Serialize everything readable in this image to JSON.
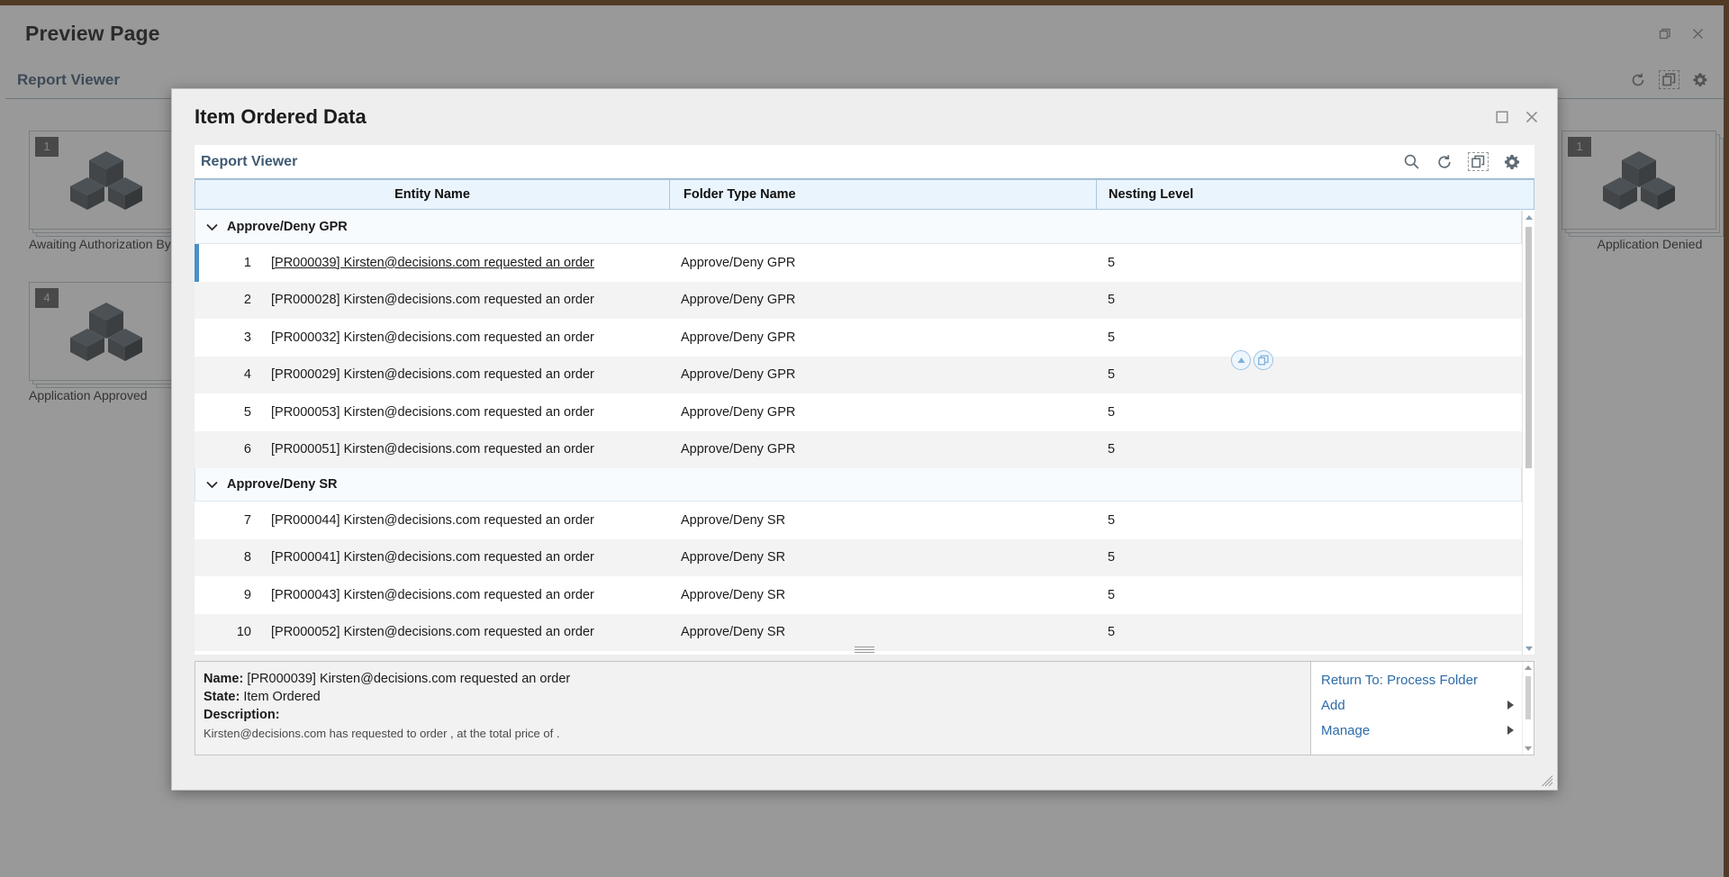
{
  "background": {
    "window_title": "Preview Page",
    "titlebar_icons": [
      "restore-icon",
      "close-icon"
    ],
    "subbar_label": "Report Viewer",
    "subbar_icons": [
      "refresh-icon",
      "copy-icon",
      "gear-icon"
    ],
    "cards_left": [
      {
        "badge": "1",
        "label": "Awaiting Authorization By Kirst",
        "icon": "cubes-icon"
      },
      {
        "badge": "4",
        "label": "Application Approved",
        "icon": "cubes-icon"
      }
    ],
    "cards_right": [
      {
        "badge": "1",
        "label": "Application Denied",
        "icon": "cubes-icon"
      }
    ]
  },
  "modal": {
    "title": "Item Ordered Data",
    "window_controls": [
      "maximize-icon",
      "close-icon"
    ],
    "toolbar": {
      "label": "Report Viewer",
      "icons": [
        "search-icon",
        "refresh-icon",
        "copy-icon",
        "gear-icon"
      ]
    },
    "grid": {
      "columns": [
        "Entity Name",
        "Folder Type Name",
        "Nesting Level"
      ],
      "sort_widgets": [
        "sort-ascending-icon",
        "group-icon"
      ],
      "groups": [
        {
          "label": "Approve/Deny GPR",
          "expanded": true,
          "rows": [
            {
              "num": "1",
              "name": "[PR000039] Kirsten@decisions.com requested an order",
              "folder_type": "Approve/Deny GPR",
              "nesting": "5",
              "selected": true
            },
            {
              "num": "2",
              "name": "[PR000028] Kirsten@decisions.com requested an order",
              "folder_type": "Approve/Deny GPR",
              "nesting": "5",
              "selected": false
            },
            {
              "num": "3",
              "name": "[PR000032] Kirsten@decisions.com requested an order",
              "folder_type": "Approve/Deny GPR",
              "nesting": "5",
              "selected": false
            },
            {
              "num": "4",
              "name": "[PR000029] Kirsten@decisions.com requested an order",
              "folder_type": "Approve/Deny GPR",
              "nesting": "5",
              "selected": false
            },
            {
              "num": "5",
              "name": "[PR000053] Kirsten@decisions.com requested an order",
              "folder_type": "Approve/Deny GPR",
              "nesting": "5",
              "selected": false
            },
            {
              "num": "6",
              "name": "[PR000051] Kirsten@decisions.com requested an order",
              "folder_type": "Approve/Deny GPR",
              "nesting": "5",
              "selected": false
            }
          ]
        },
        {
          "label": "Approve/Deny SR",
          "expanded": true,
          "rows": [
            {
              "num": "7",
              "name": "[PR000044] Kirsten@decisions.com requested an order",
              "folder_type": "Approve/Deny SR",
              "nesting": "5",
              "selected": false
            },
            {
              "num": "8",
              "name": "[PR000041] Kirsten@decisions.com requested an order",
              "folder_type": "Approve/Deny SR",
              "nesting": "5",
              "selected": false
            },
            {
              "num": "9",
              "name": "[PR000043] Kirsten@decisions.com requested an order",
              "folder_type": "Approve/Deny SR",
              "nesting": "5",
              "selected": false
            },
            {
              "num": "10",
              "name": "[PR000052] Kirsten@decisions.com requested an order",
              "folder_type": "Approve/Deny SR",
              "nesting": "5",
              "selected": false
            }
          ]
        }
      ]
    },
    "detail": {
      "name_label": "Name:",
      "name_value": "[PR000039] Kirsten@decisions.com requested an order",
      "state_label": "State:",
      "state_value": "Item Ordered",
      "description_label": "Description:",
      "description_value": "Kirsten@decisions.com has requested to order , at the total price of ."
    },
    "actions": [
      {
        "label": "Return To: Process Folder",
        "has_submenu": false
      },
      {
        "label": "Add",
        "has_submenu": true
      },
      {
        "label": "Manage",
        "has_submenu": true
      }
    ]
  },
  "colors": {
    "accent": "#2d6ca8",
    "header_bg": "#eaf4fc",
    "selection": "#4a90c4",
    "link": "#3f5a73"
  }
}
